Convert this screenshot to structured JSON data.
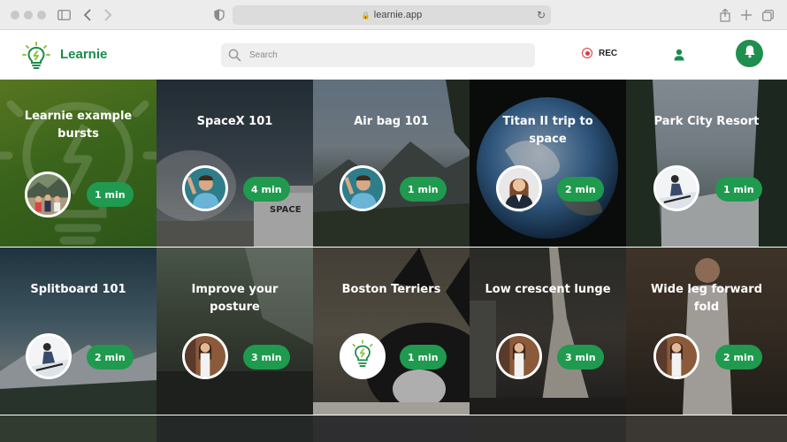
{
  "browser": {
    "url": "learnie.app"
  },
  "header": {
    "brand": "Learnie",
    "search_placeholder": "Search",
    "rec_label": "REC"
  },
  "colors": {
    "brand_green": "#1a8b4a",
    "pill_green": "#1f9a4f",
    "rec_red": "#e03a3a"
  },
  "cards": [
    {
      "title": "Learnie example bursts",
      "duration": "1 min",
      "avatar": "group-photo"
    },
    {
      "title": "SpaceX 101",
      "duration": "4 min",
      "avatar": "presenter-man"
    },
    {
      "title": "Air bag 101",
      "duration": "1 min",
      "avatar": "presenter-man"
    },
    {
      "title": "Titan II trip to space",
      "duration": "2 min",
      "avatar": "presenter-woman"
    },
    {
      "title": "Park City Resort",
      "duration": "1 min",
      "avatar": "skier"
    },
    {
      "title": "Splitboard 101",
      "duration": "2 min",
      "avatar": "skier"
    },
    {
      "title": "Improve your posture",
      "duration": "3 min",
      "avatar": "yoga-instructor"
    },
    {
      "title": "Boston Terriers",
      "duration": "1 min",
      "avatar": "learnie-logo"
    },
    {
      "title": "Low crescent lunge",
      "duration": "3 min",
      "avatar": "yoga-instructor"
    },
    {
      "title": "Wide leg forward fold",
      "duration": "2 min",
      "avatar": "yoga-instructor"
    }
  ]
}
